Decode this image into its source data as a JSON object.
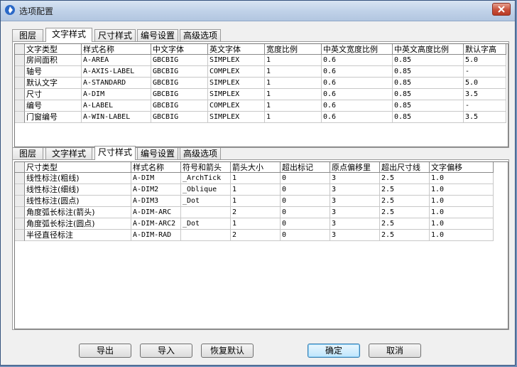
{
  "window": {
    "title": "选项配置"
  },
  "top_tabs": [
    "图层",
    "文字样式",
    "尺寸样式",
    "编号设置",
    "高级选项"
  ],
  "top_active_tab": 1,
  "bottom_tabs": [
    "图层",
    "文字样式",
    "尺寸样式",
    "编号设置",
    "高级选项"
  ],
  "bottom_active_tab": 2,
  "text_styles": {
    "columns": [
      "文字类型",
      "样式名称",
      "中文字体",
      "英文字体",
      "宽度比例",
      "中英文宽度比例",
      "中英文高度比例",
      "默认字高"
    ],
    "rows": [
      [
        "房间面积",
        "A-AREA",
        "GBCBIG",
        "SIMPLEX",
        "1",
        "0.6",
        "0.85",
        "5.0"
      ],
      [
        "轴号",
        "A-AXIS-LABEL",
        "GBCBIG",
        "COMPLEX",
        "1",
        "0.6",
        "0.85",
        "-"
      ],
      [
        "默认文字",
        "A-STANDARD",
        "GBCBIG",
        "SIMPLEX",
        "1",
        "0.6",
        "0.85",
        "5.0"
      ],
      [
        "尺寸",
        "A-DIM",
        "GBCBIG",
        "SIMPLEX",
        "1",
        "0.6",
        "0.85",
        "3.5"
      ],
      [
        "编号",
        "A-LABEL",
        "GBCBIG",
        "COMPLEX",
        "1",
        "0.6",
        "0.85",
        "-"
      ],
      [
        "门窗编号",
        "A-WIN-LABEL",
        "GBCBIG",
        "SIMPLEX",
        "1",
        "0.6",
        "0.85",
        "3.5"
      ]
    ]
  },
  "dim_styles": {
    "columns": [
      "尺寸类型",
      "样式名称",
      "符号和箭头",
      "箭头大小",
      "超出标记",
      "原点偏移里",
      "超出尺寸线",
      "文字偏移"
    ],
    "rows": [
      [
        "线性标注(粗线)",
        "A-DIM",
        "_ArchTick",
        "1",
        "0",
        "3",
        "2.5",
        "1.0"
      ],
      [
        "线性标注(细线)",
        "A-DIM2",
        "_Oblique",
        "1",
        "0",
        "3",
        "2.5",
        "1.0"
      ],
      [
        "线性标注(圆点)",
        "A-DIM3",
        "_Dot",
        "1",
        "0",
        "3",
        "2.5",
        "1.0"
      ],
      [
        "角度弧长标注(箭头)",
        "A-DIM-ARC",
        "",
        "2",
        "0",
        "3",
        "2.5",
        "1.0"
      ],
      [
        "角度弧长标注(圆点)",
        "A-DIM-ARC2",
        "_Dot",
        "1",
        "0",
        "3",
        "2.5",
        "1.0"
      ],
      [
        "半径直径标注",
        "A-DIM-RAD",
        "",
        "2",
        "0",
        "3",
        "2.5",
        "1.0"
      ]
    ]
  },
  "buttons": {
    "export": "导出",
    "import": "导入",
    "restore_default": "恢复默认",
    "ok": "确定",
    "cancel": "取消"
  },
  "icons": {
    "app": "app-icon",
    "close": "close-icon"
  }
}
